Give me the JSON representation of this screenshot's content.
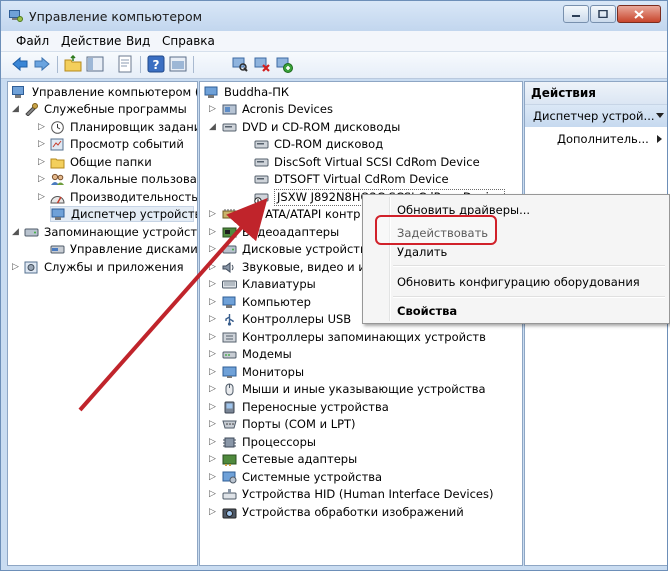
{
  "window": {
    "title": "Управление компьютером"
  },
  "menu": [
    "Файл",
    "Действие",
    "Вид",
    "Справка"
  ],
  "left_tree": [
    {
      "label": "Управление компьютером (л",
      "icon": "computer-mgmt-icon"
    },
    {
      "label": "Служебные программы",
      "icon": "tools-icon"
    },
    {
      "label": "Планировщик заданий",
      "icon": "clock-icon"
    },
    {
      "label": "Просмотр событий",
      "icon": "event-viewer-icon"
    },
    {
      "label": "Общие папки",
      "icon": "shared-folder-icon"
    },
    {
      "label": "Локальные пользовате",
      "icon": "users-icon"
    },
    {
      "label": "Производительность",
      "icon": "performance-icon"
    },
    {
      "label": "Диспетчер устройств",
      "icon": "device-manager-icon"
    },
    {
      "label": "Запоминающие устройст",
      "icon": "storage-icon"
    },
    {
      "label": "Управление дисками",
      "icon": "disk-icon"
    },
    {
      "label": "Службы и приложения",
      "icon": "services-icon"
    }
  ],
  "device_tree": [
    {
      "label": "Buddha-ПК",
      "icon": "computer-icon"
    },
    {
      "label": "Acronis Devices",
      "icon": "device-icon"
    },
    {
      "label": "DVD и CD-ROM дисководы",
      "icon": "dvd-icon"
    },
    {
      "label": "CD-ROM дисковод",
      "icon": "dvd-icon"
    },
    {
      "label": "DiscSoft Virtual SCSI CdRom Device",
      "icon": "dvd-icon"
    },
    {
      "label": "DTSOFT Virtual CdRom Device",
      "icon": "dvd-icon"
    },
    {
      "label": "JSXW J892N8HQ2C SCSI CdRom Device",
      "icon": "disabled-dvd-icon"
    },
    {
      "label": "IDE ATA/ATAPI контр",
      "icon": "ide-icon"
    },
    {
      "label": "Видеоадаптеры",
      "icon": "display-adapter-icon"
    },
    {
      "label": "Дисковые устройств",
      "icon": "disk-drive-icon"
    },
    {
      "label": "Звуковые, видео и и",
      "icon": "sound-icon"
    },
    {
      "label": "Клавиатуры",
      "icon": "keyboard-icon"
    },
    {
      "label": "Компьютер",
      "icon": "computer-icon"
    },
    {
      "label": "Контроллеры USB",
      "icon": "usb-icon"
    },
    {
      "label": "Контроллеры запоминающих устройств",
      "icon": "storage-controller-icon"
    },
    {
      "label": "Модемы",
      "icon": "modem-icon"
    },
    {
      "label": "Мониторы",
      "icon": "monitor-icon"
    },
    {
      "label": "Мыши и иные указывающие устройства",
      "icon": "mouse-icon"
    },
    {
      "label": "Переносные устройства",
      "icon": "portable-icon"
    },
    {
      "label": "Порты (COM и LPT)",
      "icon": "port-icon"
    },
    {
      "label": "Процессоры",
      "icon": "cpu-icon"
    },
    {
      "label": "Сетевые адаптеры",
      "icon": "network-icon"
    },
    {
      "label": "Системные устройства",
      "icon": "system-icon"
    },
    {
      "label": "Устройства HID (Human Interface Devices)",
      "icon": "hid-icon"
    },
    {
      "label": "Устройства обработки изображений",
      "icon": "imaging-icon"
    }
  ],
  "actions": {
    "header": "Действия",
    "selected": "Диспетчер устрой...",
    "more": "Дополнитель..."
  },
  "context_menu": {
    "update": "Обновить драйверы...",
    "enable": "Задействовать",
    "delete": "Удалить",
    "scan": "Обновить конфигурацию оборудования",
    "properties": "Свойства"
  },
  "colors": {
    "highlight": "#d1212a",
    "arrow": "#c0242b",
    "window_frame": "#c9dcf1"
  }
}
